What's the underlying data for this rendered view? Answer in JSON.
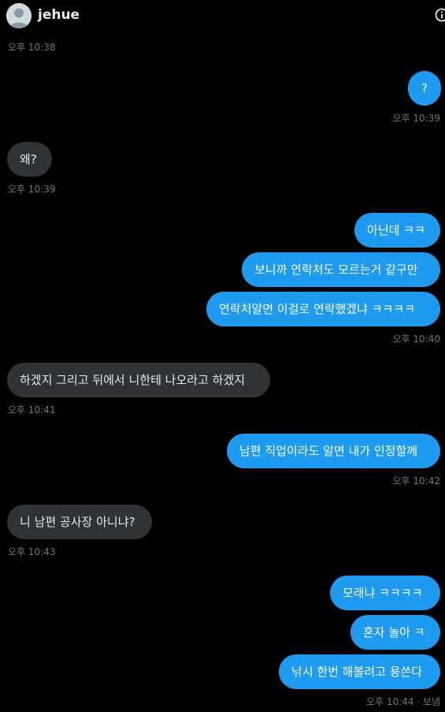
{
  "header": {
    "username": "jehue",
    "avatar_icon": "default-avatar-icon",
    "info_icon": "info-icon"
  },
  "colors": {
    "background": "#000000",
    "outgoing_bubble": "#1d9bf0",
    "incoming_bubble": "#2f3336",
    "timestamp": "#71767b"
  },
  "messages": [
    {
      "side": "in",
      "text": null,
      "timestamp": "오후 10:38"
    },
    {
      "side": "out",
      "text": "?",
      "timestamp": "오후 10:39"
    },
    {
      "side": "in",
      "text": "왜?",
      "timestamp": "오후 10:39"
    },
    {
      "side": "out",
      "text": "아닌데 ㅋㅋ"
    },
    {
      "side": "out",
      "text": "보니까 연락처도 모르는거 같구만"
    },
    {
      "side": "out",
      "text": "연락처알면 이걸로 연락했겠냐 ㅋㅋㅋㅋ",
      "timestamp": "오후 10:40"
    },
    {
      "side": "in",
      "text": "하겠지 그리고 뒤에서 니한테 나오라고 하겠지",
      "timestamp": "오후 10:41"
    },
    {
      "side": "out",
      "text": "남편 직업이라도 알면 내가 인정할께",
      "timestamp": "오후 10:42"
    },
    {
      "side": "in",
      "text": "니 남편 공사장 아니냐?",
      "timestamp": "오후 10:43"
    },
    {
      "side": "out",
      "text": "모래냐 ㅋㅋㅋㅋ"
    },
    {
      "side": "out",
      "text": "혼자 놀아 ㅋ"
    },
    {
      "side": "out",
      "text": "낚시 한번 해볼려고 용쓴다",
      "timestamp": "오후 10:44 · 보냄"
    }
  ]
}
